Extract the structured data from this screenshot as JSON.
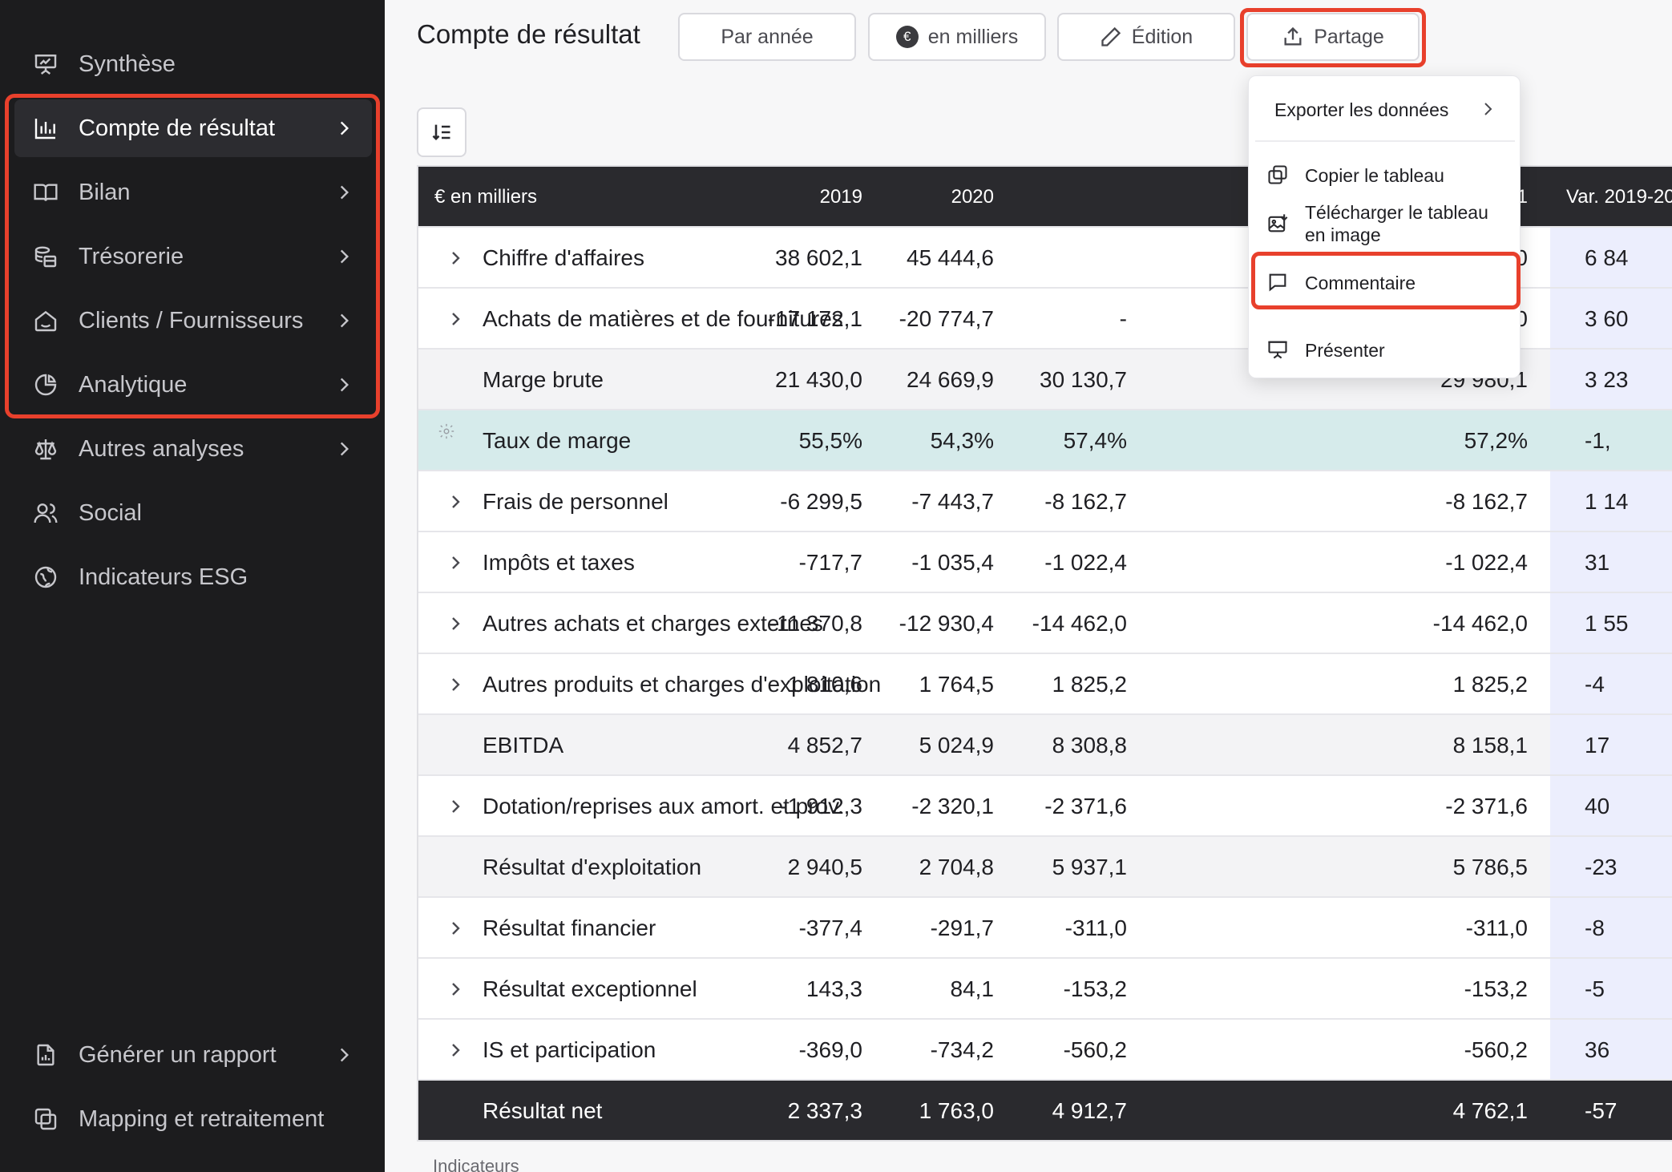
{
  "sidebar": {
    "items": [
      {
        "label": "Synthèse",
        "icon": "presentation-icon",
        "chevron": false
      },
      {
        "label": "Compte de résultat",
        "icon": "bar-chart-icon",
        "chevron": true,
        "active": true
      },
      {
        "label": "Bilan",
        "icon": "book-icon",
        "chevron": true
      },
      {
        "label": "Trésorerie",
        "icon": "coins-icon",
        "chevron": true
      },
      {
        "label": "Clients / Fournisseurs",
        "icon": "house-icon",
        "chevron": true
      },
      {
        "label": "Analytique",
        "icon": "pie-chart-icon",
        "chevron": true
      },
      {
        "label": "Autres analyses",
        "icon": "scale-icon",
        "chevron": true
      },
      {
        "label": "Social",
        "icon": "users-icon",
        "chevron": false
      },
      {
        "label": "Indicateurs ESG",
        "icon": "leaf-globe-icon",
        "chevron": false
      }
    ],
    "bottom": [
      {
        "label": "Générer un rapport",
        "icon": "report-icon",
        "chevron": true
      },
      {
        "label": "Mapping et retraitement",
        "icon": "layers-icon",
        "chevron": false
      }
    ]
  },
  "header": {
    "title": "Compte de résultat",
    "par_annee": "Par année",
    "euro_symbol": "€",
    "en_milliers": "en milliers",
    "edition": "Édition",
    "partage": "Partage"
  },
  "dropdown": {
    "export": "Exporter les données",
    "copy": "Copier le tableau",
    "download_line1": "Télécharger le tableau",
    "download_line2": "en image",
    "comment": "Commentaire",
    "present": "Présenter"
  },
  "table": {
    "unit_header": "€ en milliers",
    "col_2019": "2019",
    "col_2020": "2020",
    "col_partial": "1",
    "col_var": "Var. 2019-20",
    "rows": [
      {
        "label": "Chiffre d'affaires",
        "v2019": "38 602,1",
        "v2020": "45 444,6",
        "v3": "",
        "v4": "0",
        "var": "6 84",
        "type": "expand"
      },
      {
        "label": "Achats de matières et de fournitures",
        "v2019": "-17 172,1",
        "v2020": "-20 774,7",
        "v3": "-",
        "v4": "0",
        "var": "3 60",
        "type": "expand"
      },
      {
        "label": "Marge brute",
        "v2019": "21 430,0",
        "v2020": "24 669,9",
        "v3": "30 130,7",
        "v4": "29 980,1",
        "var": "3 23",
        "type": "sub"
      },
      {
        "label": "Taux de marge",
        "v2019": "55,5%",
        "v2020": "54,3%",
        "v3": "57,4%",
        "v4": "57,2%",
        "var": "-1,",
        "type": "taux"
      },
      {
        "label": "Frais de personnel",
        "v2019": "-6 299,5",
        "v2020": "-7 443,7",
        "v3": "-8 162,7",
        "v4": "-8 162,7",
        "var": "1 14",
        "type": "expand"
      },
      {
        "label": "Impôts et taxes",
        "v2019": "-717,7",
        "v2020": "-1 035,4",
        "v3": "-1 022,4",
        "v4": "-1 022,4",
        "var": "31",
        "type": "expand"
      },
      {
        "label": "Autres achats et charges externes",
        "v2019": "-11 370,8",
        "v2020": "-12 930,4",
        "v3": "-14 462,0",
        "v4": "-14 462,0",
        "var": "1 55",
        "type": "expand"
      },
      {
        "label": "Autres produits et charges d'exploitation",
        "v2019": "1 810,6",
        "v2020": "1 764,5",
        "v3": "1 825,2",
        "v4": "1 825,2",
        "var": "-4",
        "type": "expand"
      },
      {
        "label": "EBITDA",
        "v2019": "4 852,7",
        "v2020": "5 024,9",
        "v3": "8 308,8",
        "v4": "8 158,1",
        "var": "17",
        "type": "sub"
      },
      {
        "label": "Dotation/reprises aux amort. et prov.",
        "v2019": "-1 912,3",
        "v2020": "-2 320,1",
        "v3": "-2 371,6",
        "v4": "-2 371,6",
        "var": "40",
        "type": "expand"
      },
      {
        "label": "Résultat d'exploitation",
        "v2019": "2 940,5",
        "v2020": "2 704,8",
        "v3": "5 937,1",
        "v4": "5 786,5",
        "var": "-23",
        "type": "sub"
      },
      {
        "label": "Résultat financier",
        "v2019": "-377,4",
        "v2020": "-291,7",
        "v3": "-311,0",
        "v4": "-311,0",
        "var": "-8",
        "type": "expand"
      },
      {
        "label": "Résultat exceptionnel",
        "v2019": "143,3",
        "v2020": "84,1",
        "v3": "-153,2",
        "v4": "-153,2",
        "var": "-5",
        "type": "expand"
      },
      {
        "label": "IS et participation",
        "v2019": "-369,0",
        "v2020": "-734,2",
        "v3": "-560,2",
        "v4": "-560,2",
        "var": "36",
        "type": "expand"
      },
      {
        "label": "Résultat net",
        "v2019": "2 337,3",
        "v2020": "1 763,0",
        "v3": "4 912,7",
        "v4": "4 762,1",
        "var": "-57",
        "type": "net"
      }
    ],
    "footer": "Indicateurs"
  },
  "colors": {
    "accent_highlight": "#e8402c",
    "sidebar_bg": "#1c1c1e",
    "header_bg": "#2a2a2e",
    "taux_bg": "#d6ebeb",
    "var_bg": "#eceefd"
  }
}
